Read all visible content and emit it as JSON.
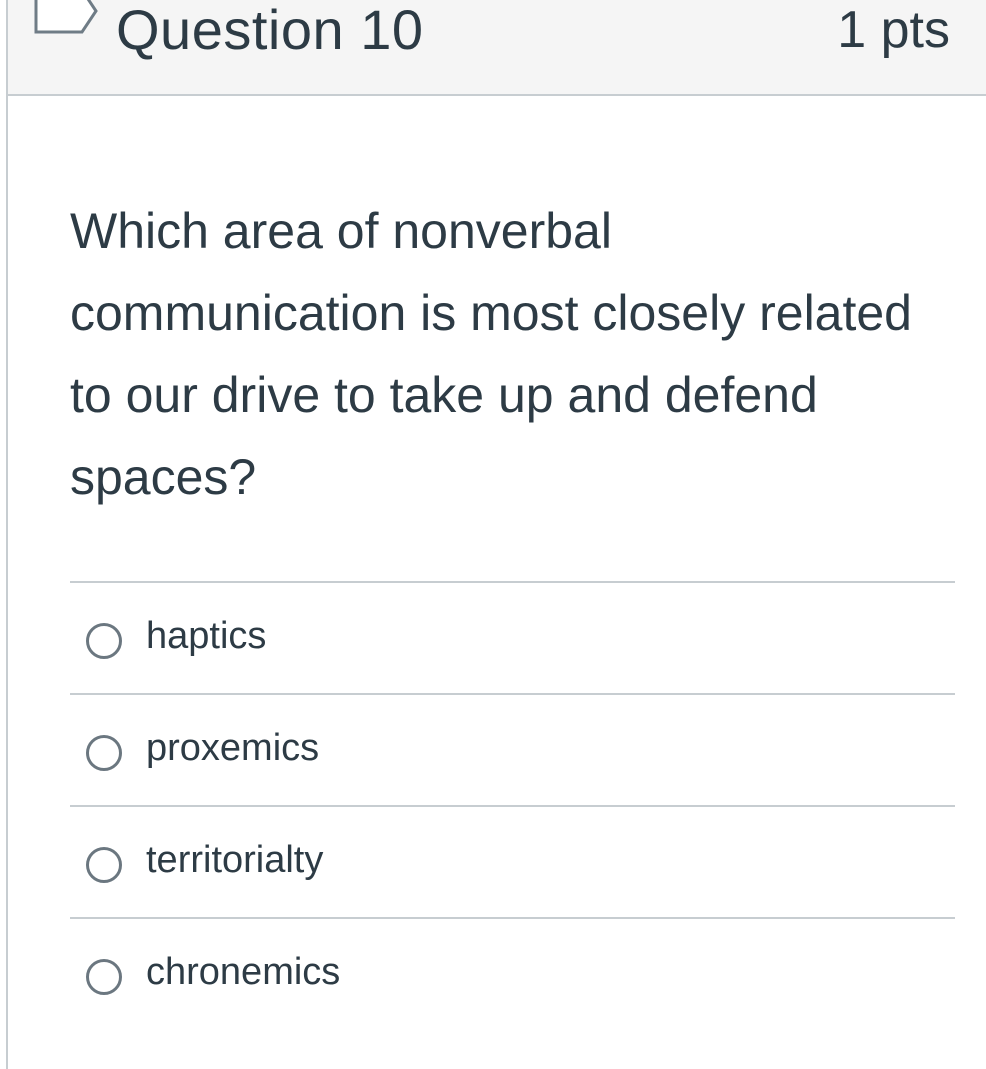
{
  "question": {
    "title": "Question 10",
    "points": "1 pts",
    "text": "Which area of nonverbal communication is most closely related to our drive to take up and defend spaces?",
    "flag_icon": "flag-outline-icon",
    "answers": [
      {
        "label": "haptics",
        "selected": false
      },
      {
        "label": "proxemics",
        "selected": false
      },
      {
        "label": "territorialty",
        "selected": false
      },
      {
        "label": "chronemics",
        "selected": false
      }
    ]
  },
  "colors": {
    "text": "#2d3b45",
    "border": "#c7cdd1",
    "header_bg": "#f5f5f5",
    "radio_border": "#6b7780"
  }
}
